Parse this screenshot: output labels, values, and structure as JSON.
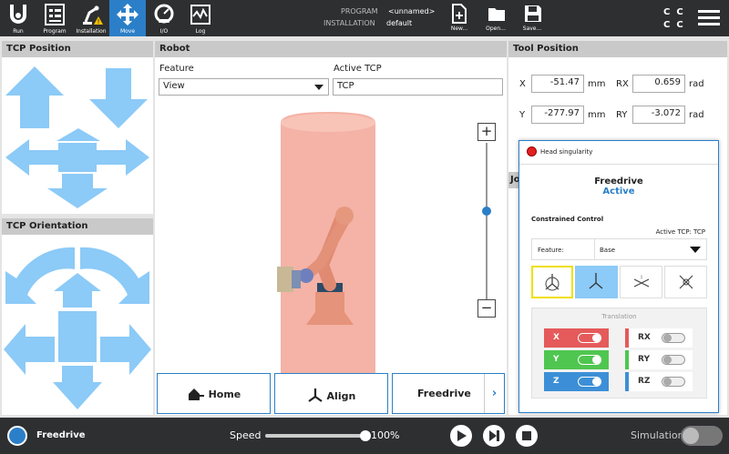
{
  "nav": {
    "items": [
      {
        "label": "Run"
      },
      {
        "label": "Program"
      },
      {
        "label": "Installation"
      },
      {
        "label": "Move"
      },
      {
        "label": "I/O"
      },
      {
        "label": "Log"
      }
    ]
  },
  "program": {
    "program_label": "PROGRAM",
    "program_value": "<unnamed>",
    "installation_label": "INSTALLATION",
    "installation_value": "default"
  },
  "file": {
    "new": "New...",
    "open": "Open...",
    "save": "Save..."
  },
  "status_icon": {
    "c": "C"
  },
  "tcp_position": {
    "title": "TCP Position"
  },
  "tcp_orientation": {
    "title": "TCP Orientation"
  },
  "robot": {
    "title": "Robot",
    "feature_label": "Feature",
    "feature_value": "View",
    "active_tcp_label": "Active TCP",
    "active_tcp_value": "TCP",
    "home": "Home",
    "align": "Align",
    "freedrive": "Freedrive"
  },
  "tool_position": {
    "title": "Tool Position",
    "x_label": "X",
    "x_value": "-51.47",
    "x_unit": "mm",
    "y_label": "Y",
    "y_value": "-277.97",
    "y_unit": "mm",
    "rx_label": "RX",
    "rx_value": "0.659",
    "rx_unit": "rad",
    "ry_label": "RY",
    "ry_value": "-3.072",
    "ry_unit": "rad",
    "joint_title_fragment": "Jo"
  },
  "popup": {
    "warning": "Head singularity",
    "title": "Freedrive",
    "state": "Active",
    "constrained": "Constrained Control",
    "active_tcp": "Active TCP: TCP",
    "feature_label": "Feature:",
    "feature_value": "Base",
    "translation": "Translation",
    "axes": [
      {
        "label": "X",
        "on": true
      },
      {
        "label": "Y",
        "on": true
      },
      {
        "label": "Z",
        "on": true
      },
      {
        "label": "RX",
        "on": false
      },
      {
        "label": "RY",
        "on": false
      },
      {
        "label": "RZ",
        "on": false
      }
    ]
  },
  "bottom": {
    "freedrive": "Freedrive",
    "speed_label": "Speed",
    "speed_value": "100%",
    "speed_fraction": 1.0,
    "simulation": "Simulation"
  },
  "colors": {
    "accent": "#2b7fc8",
    "arrow": "#8ccaf7",
    "x": "#e55a5a",
    "y": "#4fc64f",
    "z": "#3c8fd6",
    "warning": "#e02020"
  }
}
